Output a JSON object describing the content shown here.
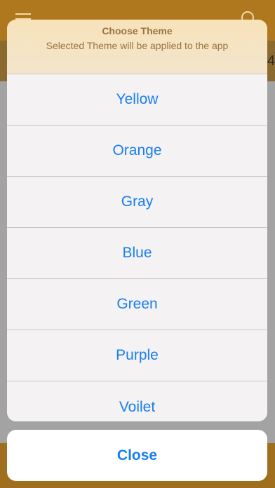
{
  "background_app": {
    "edge_digit": "4"
  },
  "sheet": {
    "title": "Choose Theme",
    "subtitle": "Selected Theme will be applied to the app",
    "options": [
      "Yellow",
      "Orange",
      "Gray",
      "Blue",
      "Green",
      "Purple",
      "Voilet"
    ],
    "close_label": "Close"
  },
  "colors": {
    "accent": "#1a7ef0",
    "header_text": "#9a7440",
    "app_bar": "#b0781e"
  }
}
